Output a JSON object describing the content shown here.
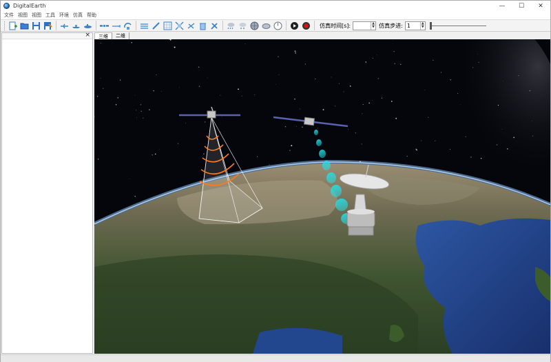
{
  "window": {
    "title": "DigitalEarth",
    "minimize_glyph": "—",
    "maximize_glyph": "☐",
    "close_glyph": "✕"
  },
  "menu": [
    "文件",
    "视图",
    "视图",
    "工具",
    "环境",
    "仿真",
    "帮助"
  ],
  "toolbar": {
    "sim_duration_label": "仿真时间[s]:",
    "sim_duration_value": "",
    "sim_step_label": "仿真步进:",
    "sim_step_value": "1",
    "step_slider_position": 0
  },
  "left_panel": {
    "close_glyph": "×"
  },
  "view_tabs": [
    {
      "label": "三维",
      "active": true
    },
    {
      "label": "二维",
      "active": false
    }
  ],
  "colors": {
    "accent_orange": "#ff7a1a",
    "beam_cyan": "#22e0e8",
    "space": "#04060c",
    "ocean": "#1d3f86"
  }
}
